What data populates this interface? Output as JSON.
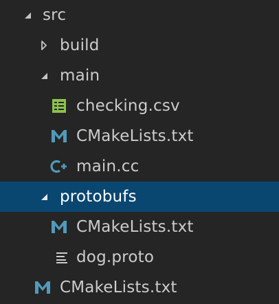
{
  "explorer": {
    "items": [
      {
        "label": "src",
        "kind": "folder",
        "state": "expanded",
        "depth": 0
      },
      {
        "label": "build",
        "kind": "folder",
        "state": "collapsed",
        "depth": 1
      },
      {
        "label": "main",
        "kind": "folder",
        "state": "expanded",
        "depth": 1
      },
      {
        "label": "checking.csv",
        "kind": "file",
        "icon": "csv-icon",
        "depth": 2
      },
      {
        "label": "CMakeLists.txt",
        "kind": "file",
        "icon": "cmake-icon",
        "depth": 2
      },
      {
        "label": "main.cc",
        "kind": "file",
        "icon": "cpp-icon",
        "depth": 2
      },
      {
        "label": "protobufs",
        "kind": "folder",
        "state": "expanded",
        "depth": 1,
        "selected": true
      },
      {
        "label": "CMakeLists.txt",
        "kind": "file",
        "icon": "cmake-icon",
        "depth": 2
      },
      {
        "label": "dog.proto",
        "kind": "file",
        "icon": "proto-icon",
        "depth": 2
      },
      {
        "label": "CMakeLists.txt",
        "kind": "file",
        "icon": "cmake-icon",
        "depth": 1
      }
    ]
  },
  "colors": {
    "background": "#252526",
    "selection": "#094771",
    "text": "#cccccc",
    "csv_icon": "#8bc34a",
    "cmake_icon": "#519aba",
    "proto_icon": "#cccccc"
  }
}
